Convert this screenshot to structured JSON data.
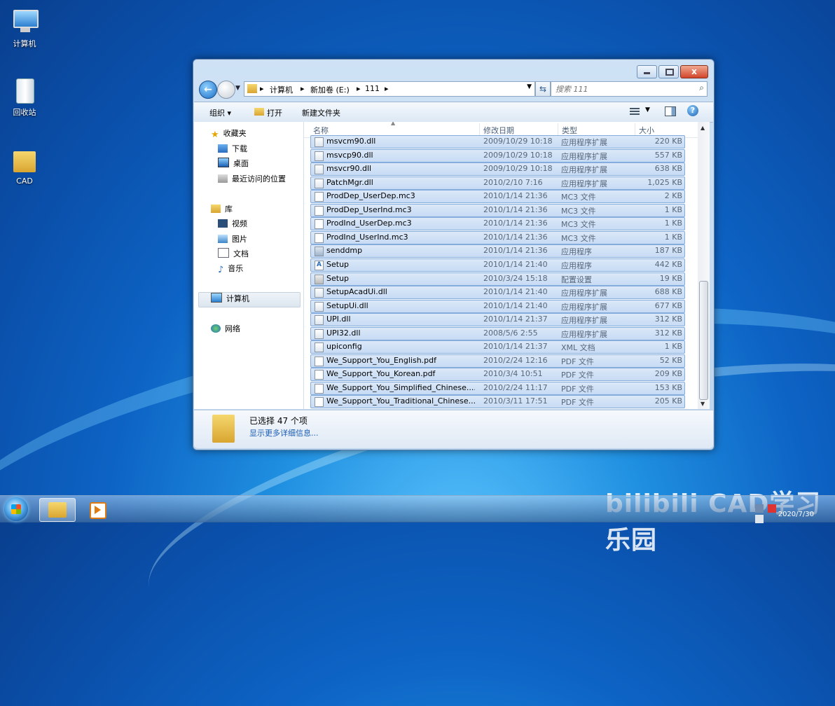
{
  "desktop": {
    "icons": [
      {
        "label": "计算机",
        "icon": "computer-icon"
      },
      {
        "label": "回收站",
        "icon": "recycle-bin-icon"
      },
      {
        "label": "CAD",
        "icon": "folder-icon"
      }
    ]
  },
  "window": {
    "caption_buttons": {
      "close": "x"
    },
    "address": {
      "crumbs": [
        "计算机",
        "新加卷 (E:)",
        "111"
      ],
      "separator": "▸"
    },
    "search": {
      "placeholder": "搜索 111"
    },
    "toolbar": {
      "organize": "组织 ▾",
      "open": "打开",
      "new_folder": "新建文件夹",
      "help": "?"
    },
    "nav": {
      "favorites": "收藏夹",
      "downloads": "下载",
      "desktop": "桌面",
      "recent": "最近访问的位置",
      "libraries": "库",
      "videos": "视频",
      "pictures": "图片",
      "documents": "文档",
      "music": "音乐",
      "computer": "计算机",
      "network": "网络"
    },
    "columns": {
      "name": "名称",
      "date": "修改日期",
      "type": "类型",
      "size": "大小"
    },
    "files": [
      {
        "name": "msvcm90.dll",
        "date": "2009/10/29 10:18",
        "type": "应用程序扩展",
        "size": "220 KB",
        "kind": "dll"
      },
      {
        "name": "msvcp90.dll",
        "date": "2009/10/29 10:18",
        "type": "应用程序扩展",
        "size": "557 KB",
        "kind": "dll"
      },
      {
        "name": "msvcr90.dll",
        "date": "2009/10/29 10:18",
        "type": "应用程序扩展",
        "size": "638 KB",
        "kind": "dll"
      },
      {
        "name": "PatchMgr.dll",
        "date": "2010/2/10 7:16",
        "type": "应用程序扩展",
        "size": "1,025 KB",
        "kind": "dll"
      },
      {
        "name": "ProdDep_UserDep.mc3",
        "date": "2010/1/14 21:36",
        "type": "MC3 文件",
        "size": "2 KB",
        "kind": "file"
      },
      {
        "name": "ProdDep_UserInd.mc3",
        "date": "2010/1/14 21:36",
        "type": "MC3 文件",
        "size": "1 KB",
        "kind": "file"
      },
      {
        "name": "ProdInd_UserDep.mc3",
        "date": "2010/1/14 21:36",
        "type": "MC3 文件",
        "size": "1 KB",
        "kind": "file"
      },
      {
        "name": "ProdInd_UserInd.mc3",
        "date": "2010/1/14 21:36",
        "type": "MC3 文件",
        "size": "1 KB",
        "kind": "file"
      },
      {
        "name": "senddmp",
        "date": "2010/1/14 21:36",
        "type": "应用程序",
        "size": "187 KB",
        "kind": "app"
      },
      {
        "name": "Setup",
        "date": "2010/1/14 21:40",
        "type": "应用程序",
        "size": "442 KB",
        "kind": "setup"
      },
      {
        "name": "Setup",
        "date": "2010/3/24 15:18",
        "type": "配置设置",
        "size": "19 KB",
        "kind": "cfg"
      },
      {
        "name": "SetupAcadUi.dll",
        "date": "2010/1/14 21:40",
        "type": "应用程序扩展",
        "size": "688 KB",
        "kind": "dll"
      },
      {
        "name": "SetupUi.dll",
        "date": "2010/1/14 21:40",
        "type": "应用程序扩展",
        "size": "677 KB",
        "kind": "dll"
      },
      {
        "name": "UPI.dll",
        "date": "2010/1/14 21:37",
        "type": "应用程序扩展",
        "size": "312 KB",
        "kind": "dll"
      },
      {
        "name": "UPI32.dll",
        "date": "2008/5/6 2:55",
        "type": "应用程序扩展",
        "size": "312 KB",
        "kind": "dll"
      },
      {
        "name": "upiconfig",
        "date": "2010/1/14 21:37",
        "type": "XML 文档",
        "size": "1 KB",
        "kind": "dll"
      },
      {
        "name": "We_Support_You_English.pdf",
        "date": "2010/2/24 12:16",
        "type": "PDF 文件",
        "size": "52 KB",
        "kind": "file"
      },
      {
        "name": "We_Support_You_Korean.pdf",
        "date": "2010/3/4 10:51",
        "type": "PDF 文件",
        "size": "209 KB",
        "kind": "file"
      },
      {
        "name": "We_Support_You_Simplified_Chinese....",
        "date": "2010/2/24 11:17",
        "type": "PDF 文件",
        "size": "153 KB",
        "kind": "file"
      },
      {
        "name": "We_Support_You_Traditional_Chinese...",
        "date": "2010/3/11 17:51",
        "type": "PDF 文件",
        "size": "205 KB",
        "kind": "file"
      }
    ],
    "details": {
      "selected": "已选择 47 个项",
      "more": "显示更多详细信息..."
    }
  },
  "taskbar": {
    "clock": "2020/7/30"
  },
  "watermark": "bilibili CAD学习乐园"
}
